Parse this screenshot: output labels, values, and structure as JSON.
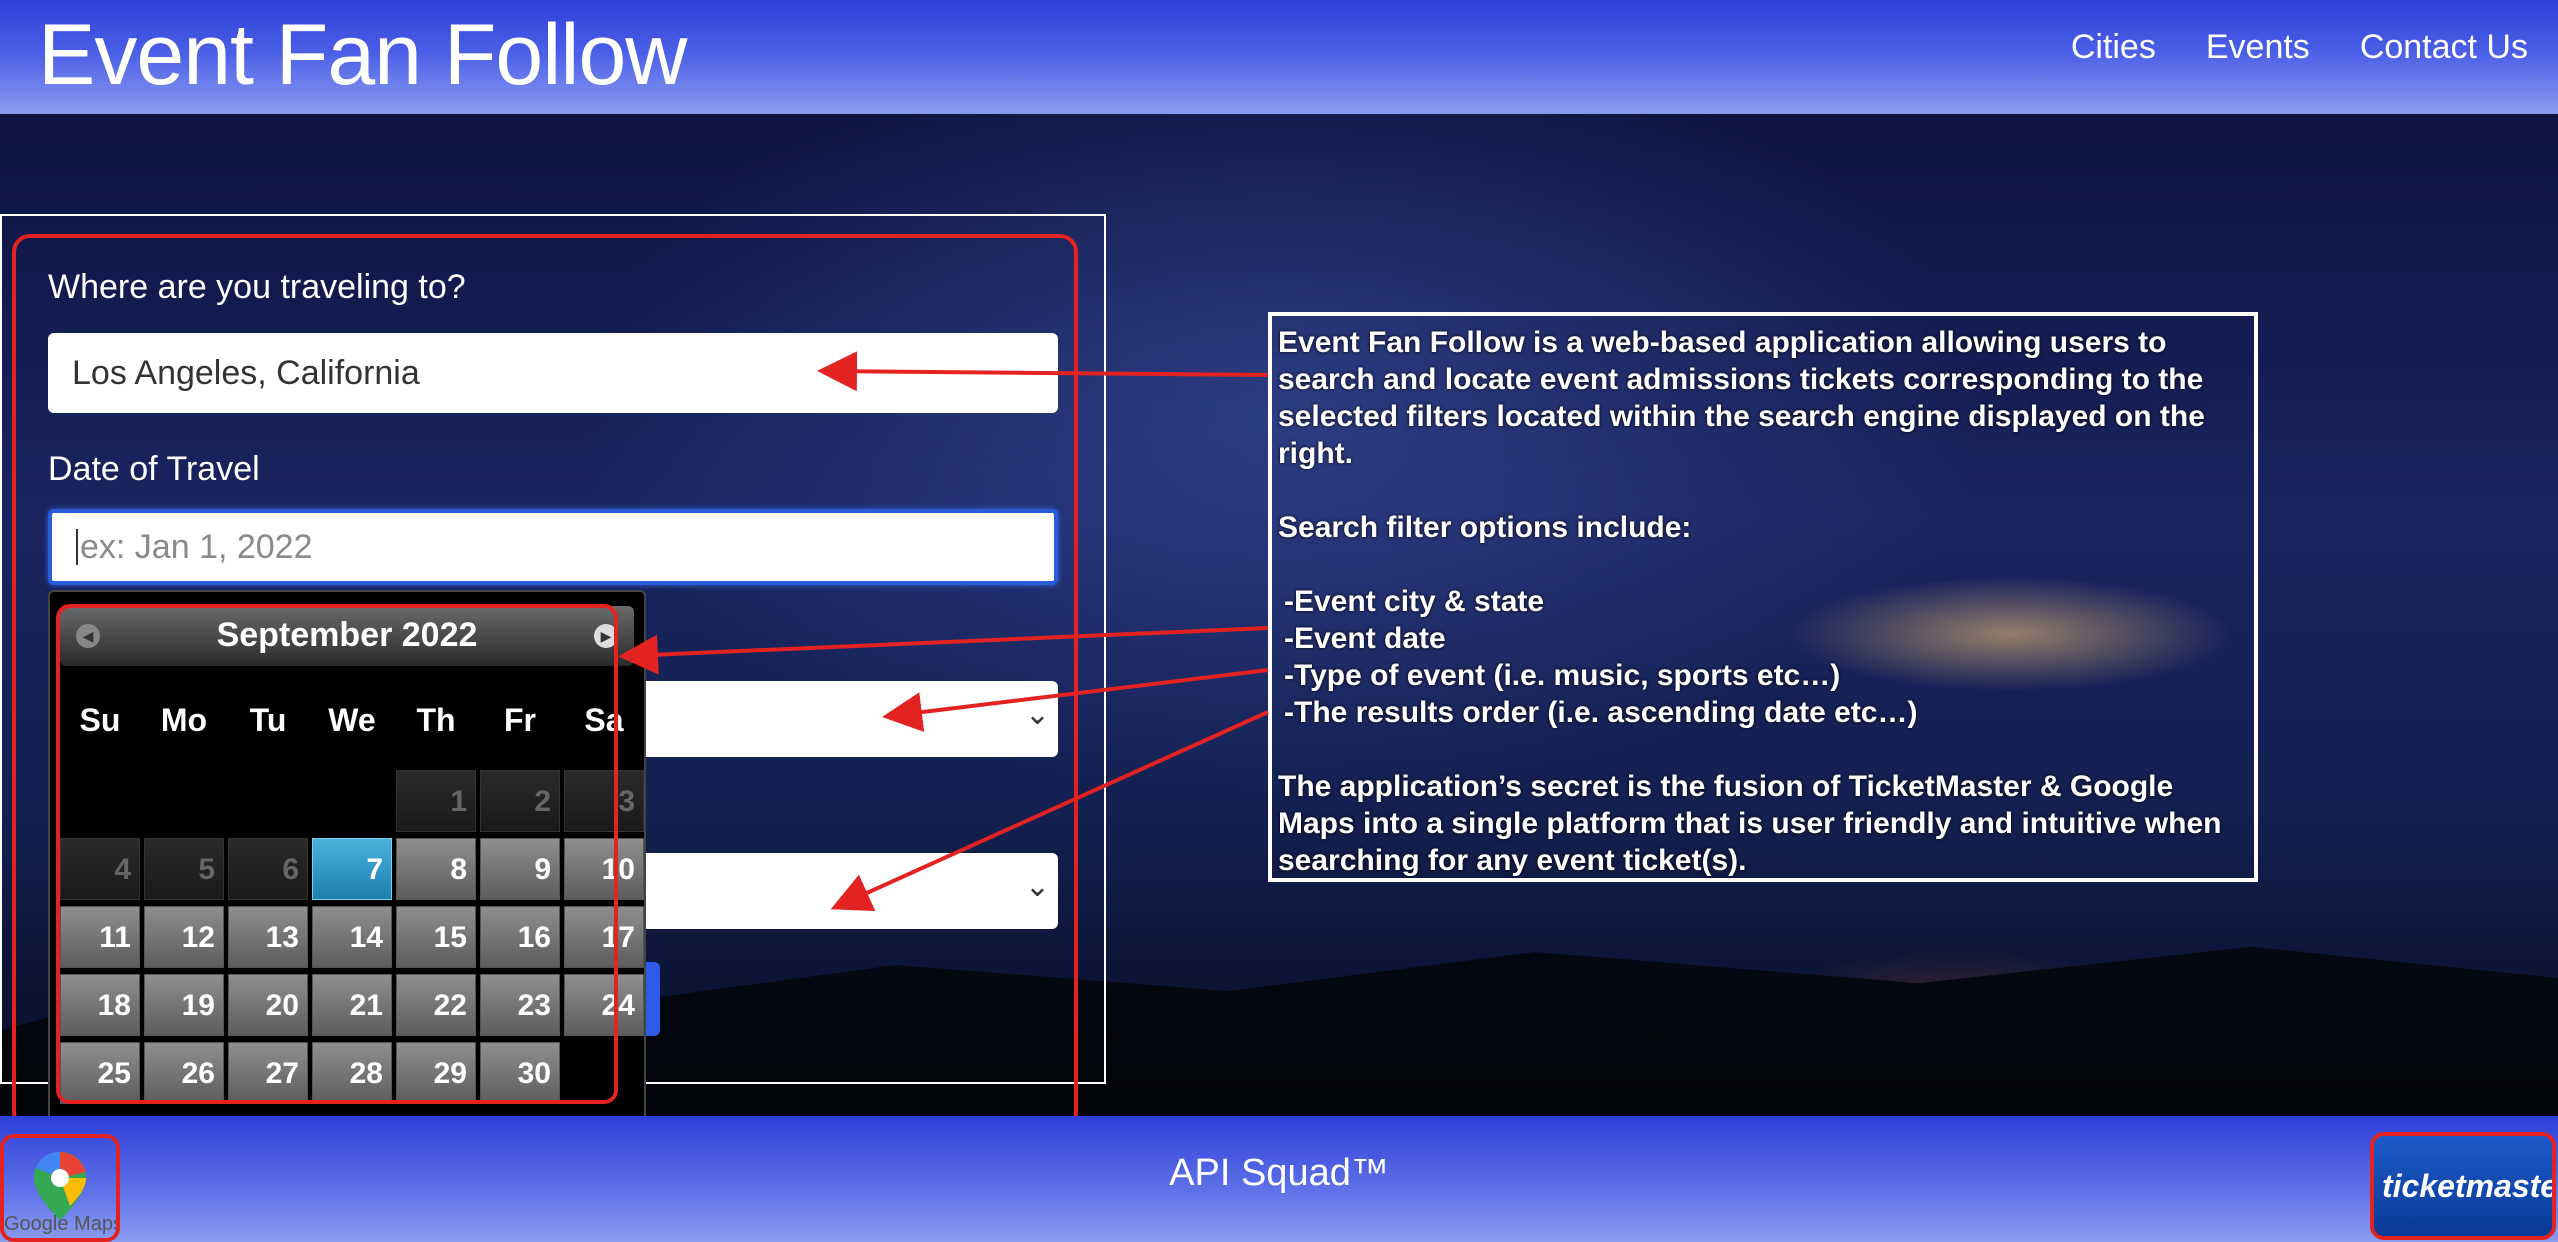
{
  "header": {
    "brand": "Event Fan Follow",
    "nav": [
      "Cities",
      "Events",
      "Contact Us"
    ]
  },
  "form": {
    "destination_label": "Where are you traveling to?",
    "destination_value": "Los Angeles, California",
    "date_label": "Date of Travel",
    "date_placeholder": "ex: Jan 1, 2022"
  },
  "datepicker": {
    "title": "September 2022",
    "weekdays": [
      "Su",
      "Mo",
      "Tu",
      "We",
      "Th",
      "Fr",
      "Sa"
    ],
    "days": [
      "1",
      "2",
      "3",
      "4",
      "5",
      "6",
      "7",
      "8",
      "9",
      "10",
      "11",
      "12",
      "13",
      "14",
      "15",
      "16",
      "17",
      "18",
      "19",
      "20",
      "21",
      "22",
      "23",
      "24",
      "25",
      "26",
      "27",
      "28",
      "29",
      "30"
    ],
    "selected_day": "7",
    "disabled_days": [
      "1",
      "2",
      "3",
      "4",
      "5",
      "6"
    ]
  },
  "description": {
    "intro": "Event Fan Follow is a web-based application allowing users to search and locate event admissions tickets corresponding to the selected filters located within the search engine displayed on the right.",
    "filters_heading": "Search filter options include:",
    "filters": [
      "-Event city & state",
      "-Event date",
      "-Type of event (i.e. music, sports etc…)",
      "-The results order (i.e. ascending date etc…)"
    ],
    "secret": "The application’s secret is the fusion of TicketMaster & Google Maps into a single platform that is user friendly and intuitive when searching for any event ticket(s)."
  },
  "footer": {
    "text": "API Squad™",
    "gmaps_label": "Google Maps",
    "ticketmaster_label": "ticketmaster"
  },
  "colors": {
    "header_blue": "#2d3fd8",
    "annotation_red": "#e32222",
    "selected_day": "#1b7eb0"
  }
}
